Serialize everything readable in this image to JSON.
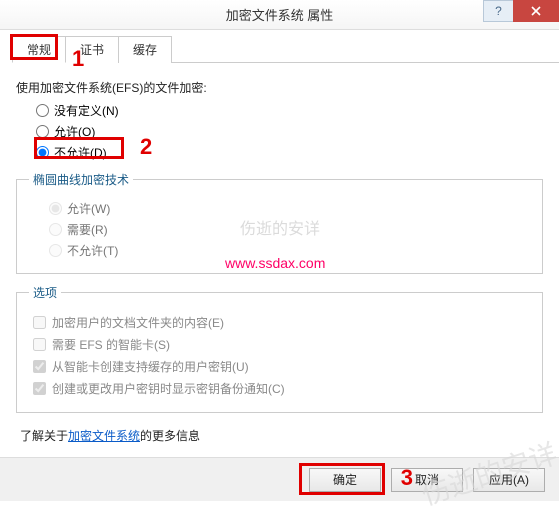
{
  "window": {
    "title": "加密文件系统 属性"
  },
  "tabs": {
    "general": "常规",
    "cert": "证书",
    "cache": "缓存"
  },
  "efs": {
    "heading": "使用加密文件系统(EFS)的文件加密:",
    "opt_none": "没有定义(N)",
    "opt_allow": "允许(O)",
    "opt_deny": "不允许(D)"
  },
  "ecc": {
    "legend": "椭圆曲线加密技术",
    "allow": "允许(W)",
    "require": "需要(R)",
    "deny": "不允许(T)"
  },
  "options": {
    "legend": "选项",
    "encrypt_docs": "加密用户的文档文件夹的内容(E)",
    "need_smartcard": "需要 EFS 的智能卡(S)",
    "cache_key": "从智能卡创建支持缓存的用户密钥(U)",
    "backup_notify": "创建或更改用户密钥时显示密钥备份通知(C)"
  },
  "info": {
    "prefix": "了解关于",
    "link": "加密文件系统",
    "suffix": "的更多信息"
  },
  "buttons": {
    "ok": "确定",
    "cancel": "取消",
    "apply": "应用(A)"
  },
  "annotations": {
    "a1": "1",
    "a2": "2",
    "a3": "3"
  },
  "watermark": {
    "w1": "伤逝的安详",
    "w2": "www.ssdax.com",
    "w3": "伤逝的安详"
  }
}
